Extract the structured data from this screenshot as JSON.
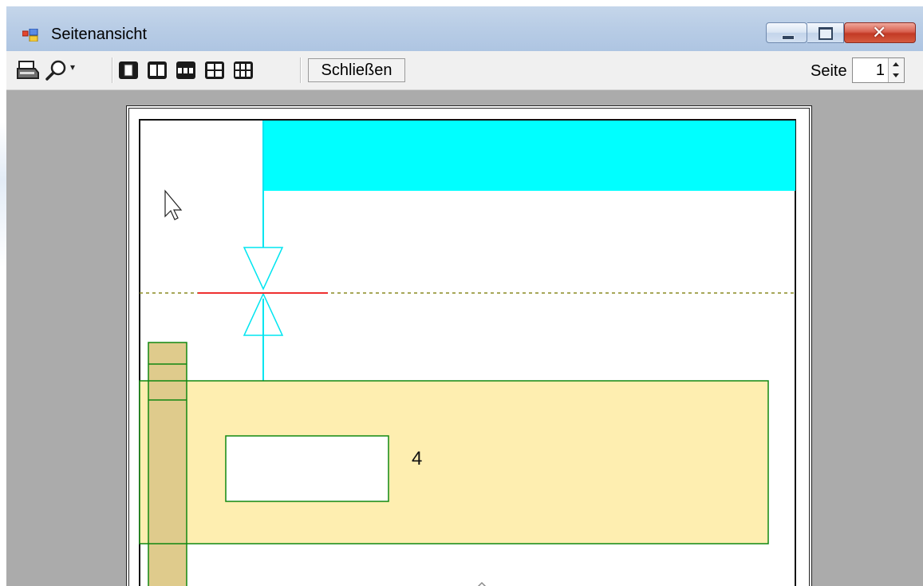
{
  "window": {
    "title": "Seitenansicht",
    "controls": [
      "minimize",
      "maximize",
      "close"
    ]
  },
  "toolbar": {
    "print_icon": "printer-icon",
    "zoom_icon": "magnifier-icon",
    "layout_icons": [
      "one-page-icon",
      "two-pages-icon",
      "three-pages-icon",
      "four-pages-icon",
      "six-pages-icon"
    ],
    "close_label": "Schließen",
    "page_label": "Seite",
    "page_value": "1"
  },
  "preview": {
    "drawing_label": "4",
    "colors": {
      "cyan_fill": "#00ffff",
      "light_yellow_fill": "#feeeb0",
      "tan_fill": "#dfcb8c",
      "green_stroke": "#118811",
      "red_line": "#ee3030",
      "dotted_line": "#8a8a20"
    }
  }
}
